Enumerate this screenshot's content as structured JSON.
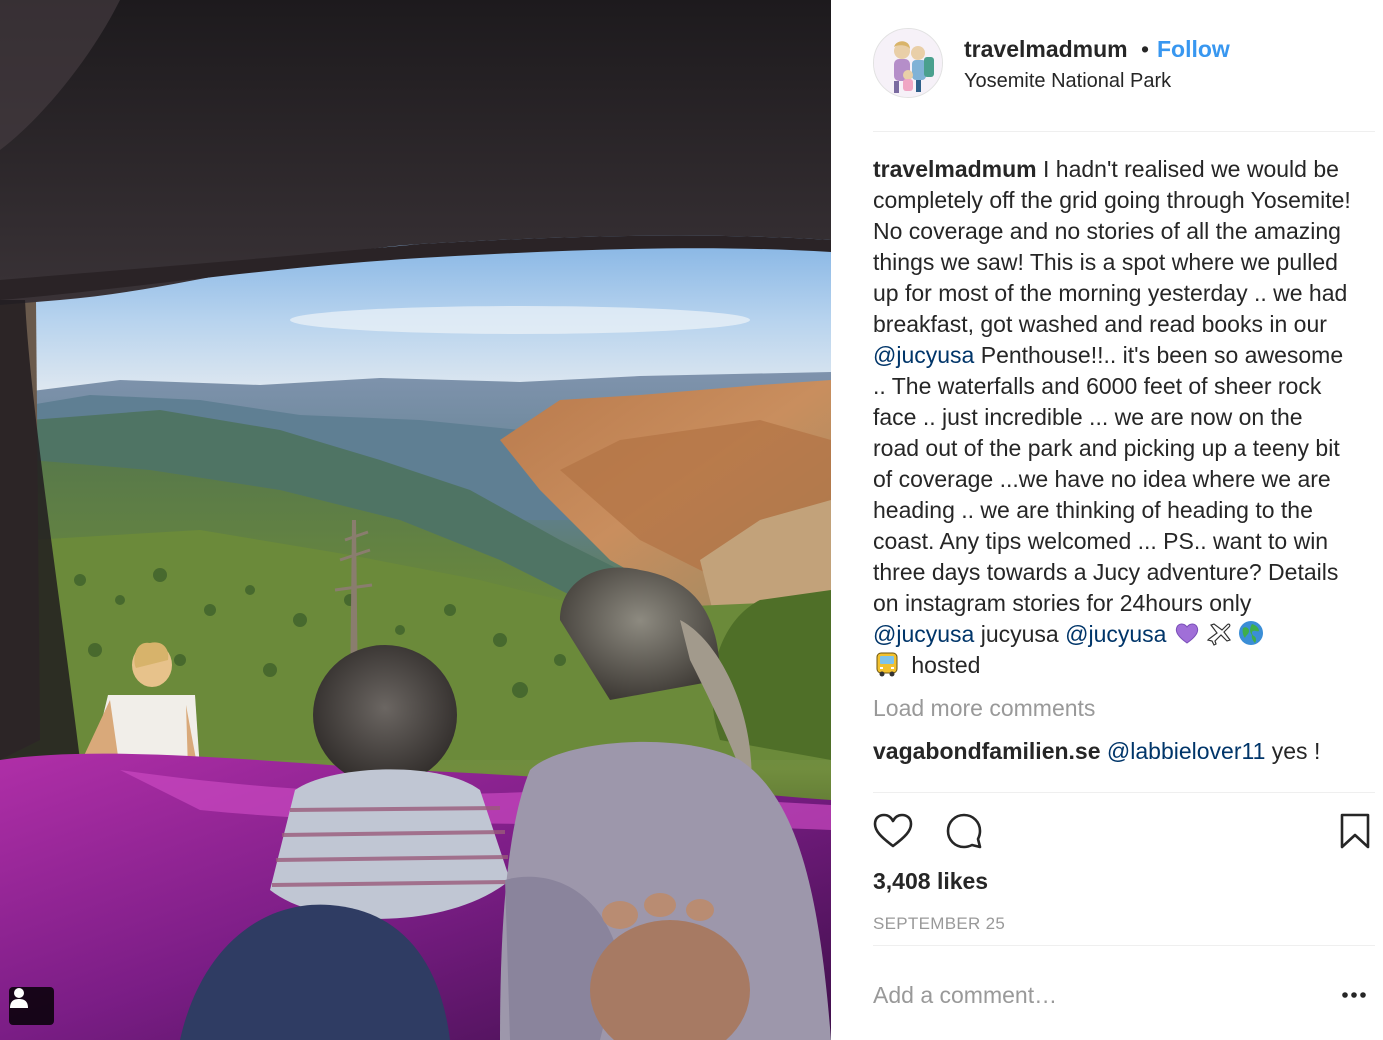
{
  "post": {
    "username": "travelmadmum",
    "separator": "•",
    "follow_label": "Follow",
    "location": "Yosemite National Park"
  },
  "caption": {
    "username": "travelmadmum",
    "text_1": " I hadn't realised we would be completely off the grid going through Yosemite! No coverage and no stories of all the amazing things we saw! This is a spot where we pulled up for most of the morning yesterday .. we had breakfast, got washed and read books in our ",
    "mention_1": "@jucyusa",
    "text_2": " Penthouse!!.. it's been so awesome .. The waterfalls and 6000 feet of sheer rock face .. just incredible ... we are now on the road out of the park and picking up a teeny bit of coverage ...we have no idea where we are heading .. we are thinking of heading to the coast. Any tips welcomed ... PS.. want to win three days towards a Jucy adventure? Details on instagram stories for 24hours only ",
    "mention_2": "@jucyusa",
    "text_3": " jucyusa ",
    "mention_3": "@jucyusa",
    "emojis": [
      "purple-heart-icon",
      "airplane-icon",
      "globe-icon",
      "bus-icon"
    ],
    "text_4": " hosted"
  },
  "load_more_label": "Load more comments",
  "next_comment": {
    "username": "vagabondfamilien.se",
    "mention": "@labbielover11",
    "text": " yes !"
  },
  "likes_text": "3,408 likes",
  "date_text": "SEPTEMBER 25",
  "add_comment_placeholder": "Add a comment…",
  "colors": {
    "link_blue": "#3897f0",
    "mention_blue": "#003569",
    "muted_gray": "#999999",
    "text": "#262626",
    "divider": "#efefef"
  }
}
